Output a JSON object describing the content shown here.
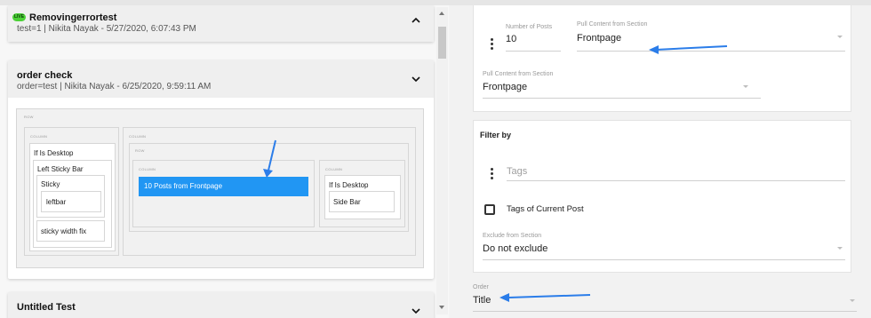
{
  "left": {
    "cards": [
      {
        "badge": "LIVE",
        "title": "Removingerrortest",
        "subtitle": "test=1 | Nikita Nayak - 5/27/2020, 6:07:43 PM",
        "chevron": "chevron-up-icon"
      },
      {
        "title": "order check",
        "subtitle": "order=test | Nikita Nayak - 6/25/2020, 9:59:11 AM",
        "chevron": "chevron-down-icon",
        "layout": {
          "row_label": "ROW",
          "column_label": "COLUMN",
          "left_column": {
            "if_desktop": "If Is Desktop",
            "left_sticky_bar": "Left Sticky Bar",
            "sticky": "Sticky",
            "leftbar": "leftbar",
            "sticky_width_fix": "sticky width fix"
          },
          "main_column": {
            "inner_row_label": "ROW",
            "col1_label": "COLUMN",
            "posts_block": "10 Posts from Frontpage",
            "col2_label": "COLUMN",
            "if_desktop": "If Is Desktop",
            "side_bar": "Side Bar"
          }
        }
      },
      {
        "title": "Untitled Test",
        "chevron": "chevron-down-icon"
      }
    ]
  },
  "right": {
    "posts_settings": {
      "number_of_posts_label": "Number of Posts",
      "number_of_posts_value": "10",
      "pull_content_label_1": "Pull Content from Section",
      "pull_content_value_1": "Frontpage",
      "pull_content_label_2": "Pull Content from Section",
      "pull_content_value_2": "Frontpage"
    },
    "filter": {
      "heading": "Filter by",
      "tags_placeholder": "Tags",
      "tags_current_post": "Tags of Current Post",
      "exclude_label": "Exclude from Section",
      "exclude_value": "Do not exclude"
    },
    "order": {
      "label": "Order",
      "value": "Title"
    }
  },
  "colors": {
    "accent_blue": "#2196f3",
    "live_green": "#4cd137",
    "annotation_arrow": "#2b7de9"
  }
}
